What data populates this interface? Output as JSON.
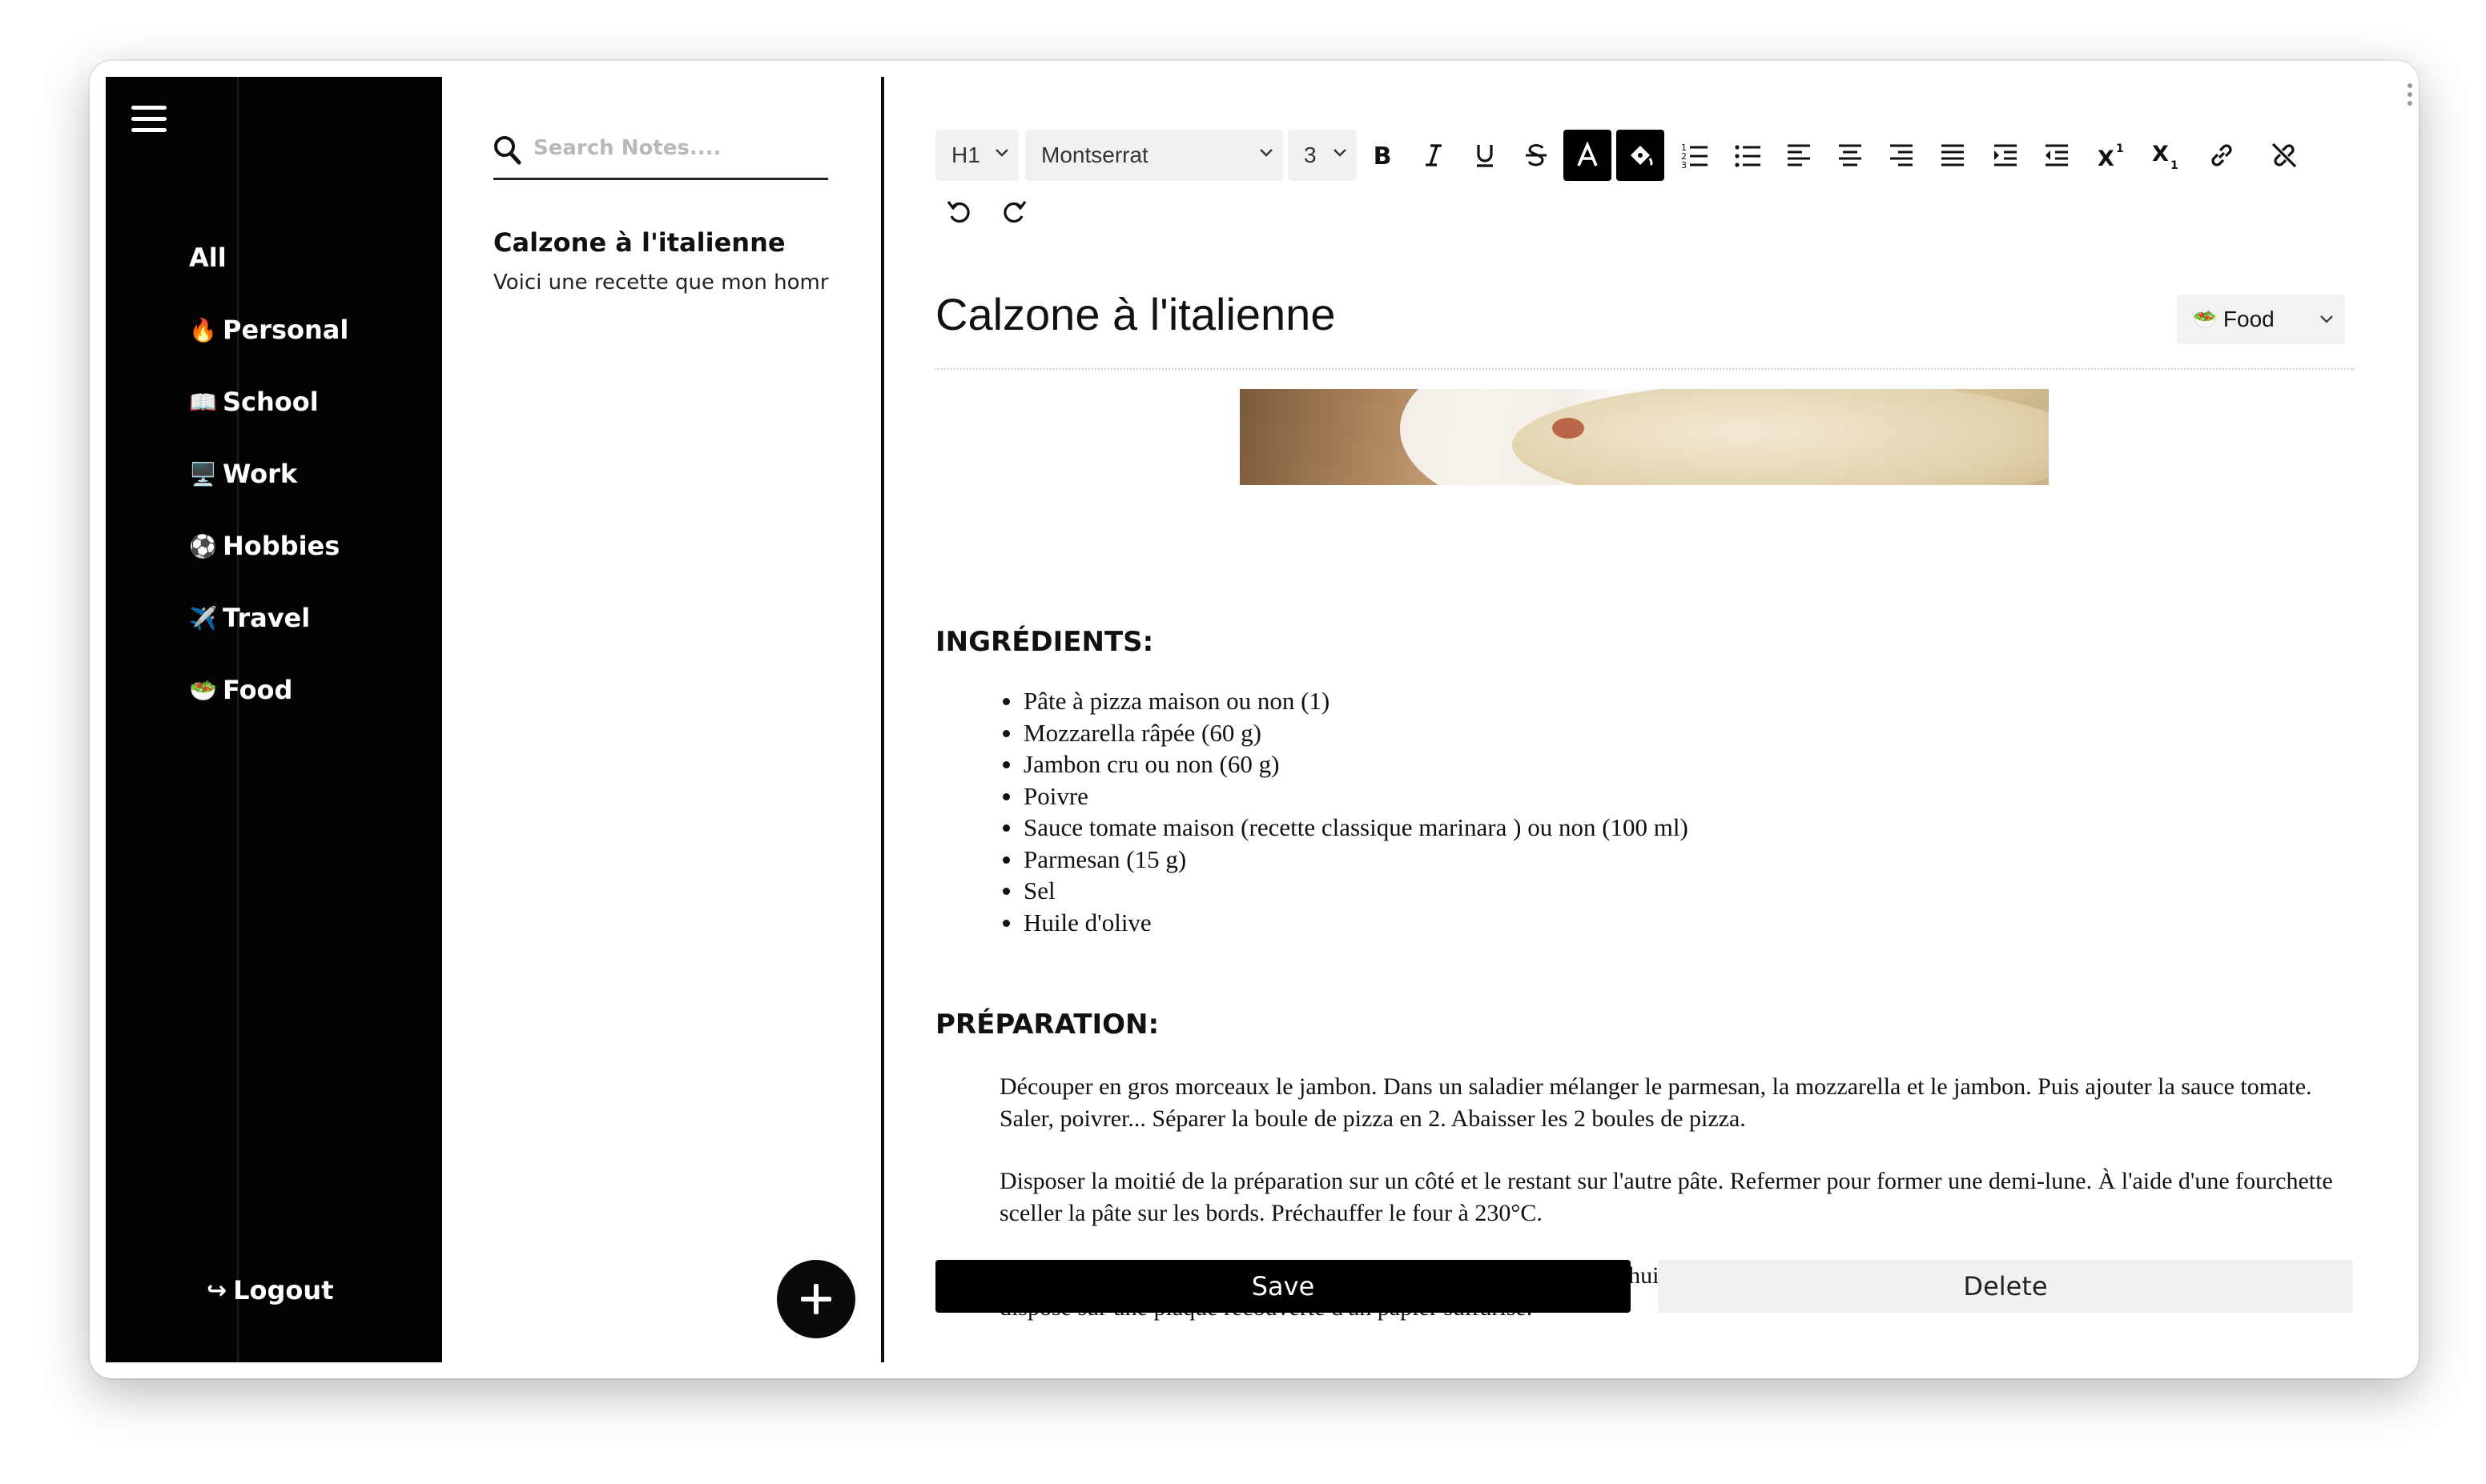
{
  "sidebar": {
    "menu_icon": "hamburger-icon",
    "items": [
      {
        "emoji": "",
        "label": "All"
      },
      {
        "emoji": "🔥",
        "label": "Personal"
      },
      {
        "emoji": "📖",
        "label": "School"
      },
      {
        "emoji": "🖥️",
        "label": "Work"
      },
      {
        "emoji": "⚽",
        "label": "Hobbies"
      },
      {
        "emoji": "✈️",
        "label": "Travel"
      },
      {
        "emoji": "🥗",
        "label": "Food"
      }
    ],
    "logout_icon": "↪",
    "logout_label": "Logout"
  },
  "notes_list": {
    "search_placeholder": "Search Notes....",
    "notes": [
      {
        "title": "Calzone à l'italienne",
        "preview": "Voici une recette que mon homr"
      }
    ],
    "add_icon": "plus-icon"
  },
  "toolbar": {
    "heading": "H1",
    "font": "Montserrat",
    "size": "3",
    "buttons": [
      "bold",
      "italic",
      "underline",
      "strikethrough",
      "font-color",
      "highlight",
      "ordered-list",
      "bullet-list",
      "align-left",
      "align-center",
      "align-right",
      "justify",
      "indent",
      "outdent",
      "superscript",
      "subscript",
      "link",
      "unlink",
      "undo",
      "redo"
    ]
  },
  "note": {
    "title": "Calzone à l'italienne",
    "category": {
      "emoji": "🥗",
      "label": "Food"
    },
    "ingredients_heading": "INGRÉDIENTS:",
    "ingredients": [
      "Pâte à pizza maison ou non (1)",
      "Mozzarella râpée (60 g)",
      "Jambon cru ou non (60 g)",
      "Poivre",
      "Sauce tomate maison (recette classique marinara ) ou non (100 ml)",
      "Parmesan (15 g)",
      "Sel",
      "Huile d'olive"
    ],
    "preparation_heading": "PRÉPARATION:",
    "preparation": [
      "Découper en gros morceaux le jambon. Dans un saladier mélanger le parmesan, la mozzarella et le jambon. Puis ajouter la sauce tomate. Saler, poivrer... Séparer la boule de pizza en 2. Abaisser les 2 boules de pizza.",
      "Disposer la moitié de la préparation sur un côté et le restant sur l'autre pâte. Refermer pour former une demi-lune. À l'aide d'une fourchette sceller la pâte sur les bords. Préchauffer le four à 230°C.",
      "À l'aide d'un pinceau, badigeonner le dessus de chaque calzone d'huile d'olive. Soyez généreux ! Enfourner les calzones après les avoir disposé sur une plaque recouverte d'un papier sulfurisé."
    ]
  },
  "actions": {
    "save": "Save",
    "delete": "Delete"
  }
}
